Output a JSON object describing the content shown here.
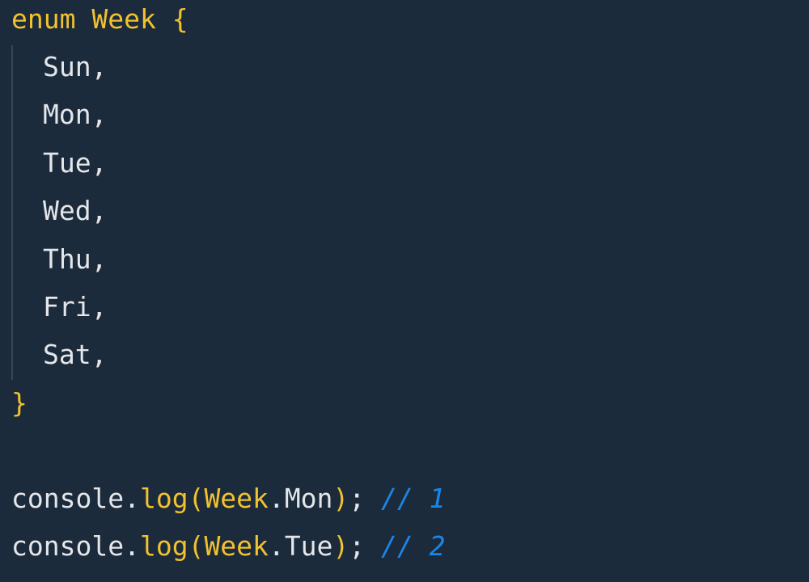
{
  "code": {
    "enum_keyword": "enum",
    "enum_name": "Week",
    "open_brace": "{",
    "close_brace": "}",
    "members": [
      "Sun,",
      "Mon,",
      "Tue,",
      "Wed,",
      "Thu,",
      "Fri,",
      "Sat,"
    ],
    "log_lines": [
      {
        "object": "console",
        "dot1": ".",
        "method": "log",
        "open_paren": "(",
        "arg_object": "Week",
        "dot2": ".",
        "arg_member": "Mon",
        "close_paren": ")",
        "semicolon": ";",
        "comment": "// 1"
      },
      {
        "object": "console",
        "dot1": ".",
        "method": "log",
        "open_paren": "(",
        "arg_object": "Week",
        "dot2": ".",
        "arg_member": "Tue",
        "close_paren": ")",
        "semicolon": ";",
        "comment": "// 2"
      }
    ]
  },
  "colors": {
    "background": "#1b2b3c",
    "default_text": "#e4e6ea",
    "keyword_yellow": "#f2c12e",
    "comment_blue": "#1a86e8",
    "indent_guide": "#34475a"
  }
}
